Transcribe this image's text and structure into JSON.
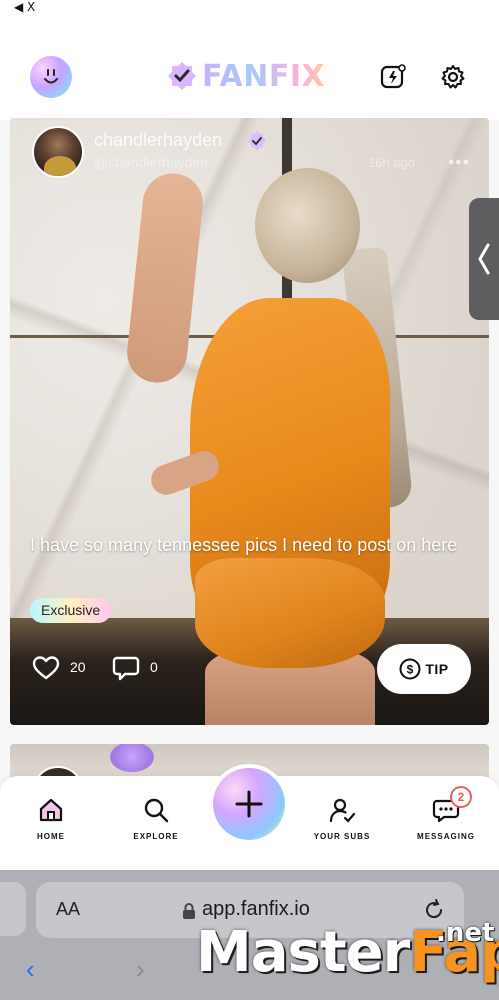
{
  "status_bar": {
    "back_label": "◀ X"
  },
  "header": {
    "logo_text": "FANFIX",
    "icons": [
      "smiley-icon",
      "lightning-post-icon",
      "settings-gear-icon"
    ]
  },
  "post": {
    "username": "chandlerhayden",
    "handle": "@chandlerhayden",
    "time": "16h ago",
    "caption": "I have so many tennessee pics I need to post on here",
    "badge": "Exclusive",
    "likes": "20",
    "comments": "0",
    "tip_label": "TIP"
  },
  "bottom_nav": {
    "items": [
      {
        "label": "HOME",
        "icon": "home-icon"
      },
      {
        "label": "EXPLORE",
        "icon": "search-icon"
      },
      {
        "label": "YOUR SUBS",
        "icon": "subscriptions-icon"
      },
      {
        "label": "MESSAGING",
        "icon": "chat-icon"
      }
    ],
    "messaging_badge": "2"
  },
  "browser": {
    "text_size_label": "AA",
    "url": "app.fanfix.io"
  },
  "watermark": {
    "main": "MasterFap",
    "accent_part": "Fap",
    "suffix": ".net"
  },
  "colors": {
    "accent_gradient": [
      "#c9b2ff",
      "#a5c8ff",
      "#ffb1d8"
    ],
    "badge_red": "#f15b5b",
    "safari_blue": "#2f6fe0"
  }
}
